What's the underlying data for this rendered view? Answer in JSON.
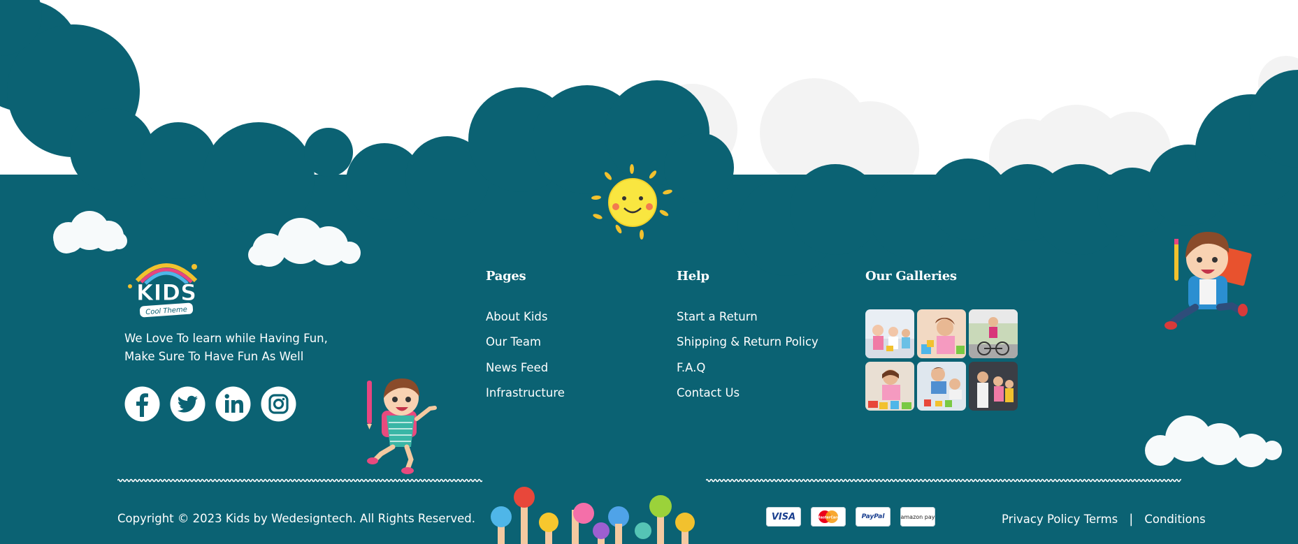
{
  "brand": {
    "logo_title": "KIDS",
    "logo_subtitle": "Cool Theme",
    "tagline_line1": "We Love To learn while Having Fun,",
    "tagline_line2": "Make Sure To Have Fun As Well"
  },
  "social": [
    {
      "name": "facebook-icon"
    },
    {
      "name": "twitter-icon"
    },
    {
      "name": "linkedin-icon"
    },
    {
      "name": "instagram-icon"
    }
  ],
  "pages": {
    "title": "Pages",
    "links": [
      "About Kids",
      "Our Team",
      "News Feed",
      "Infrastructure"
    ]
  },
  "help": {
    "title": "Help",
    "links": [
      "Start a Return",
      "Shipping & Return Policy",
      "F.A.Q",
      "Contact Us"
    ]
  },
  "galleries": {
    "title": "Our Galleries"
  },
  "footer": {
    "copyright": "Copyright © 2023 Kids by Wedesigntech. All Rights Reserved.",
    "payments": [
      "VISA",
      "MasterCard",
      "PayPal",
      "amazon pay"
    ],
    "legal_link1": "Privacy Policy Terms",
    "separator": "|",
    "legal_link2": "Conditions"
  },
  "colors": {
    "footer_bg": "#0b6273",
    "accent_yellow": "#f5d92a",
    "cloud_white": "#f7fafb",
    "light_cloud": "#f2f2f2"
  }
}
